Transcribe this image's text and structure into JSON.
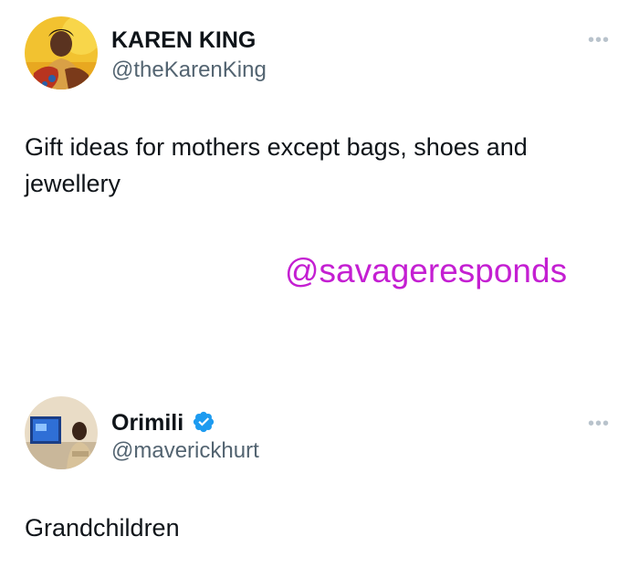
{
  "tweet1": {
    "display_name": "KAREN KING",
    "handle": "@theKarenKing",
    "text": "Gift ideas for mothers except bags, shoes and jewellery",
    "more_icon": "more-options-icon"
  },
  "watermark": "@savageresponds",
  "tweet2": {
    "display_name": "Orimili",
    "verified": true,
    "handle": "@maverickhurt",
    "text": "Grandchildren",
    "more_icon": "more-options-icon"
  },
  "colors": {
    "text": "#0f1419",
    "secondary": "#536471",
    "watermark": "#c41fd2",
    "verified": "#1d9bf0"
  }
}
